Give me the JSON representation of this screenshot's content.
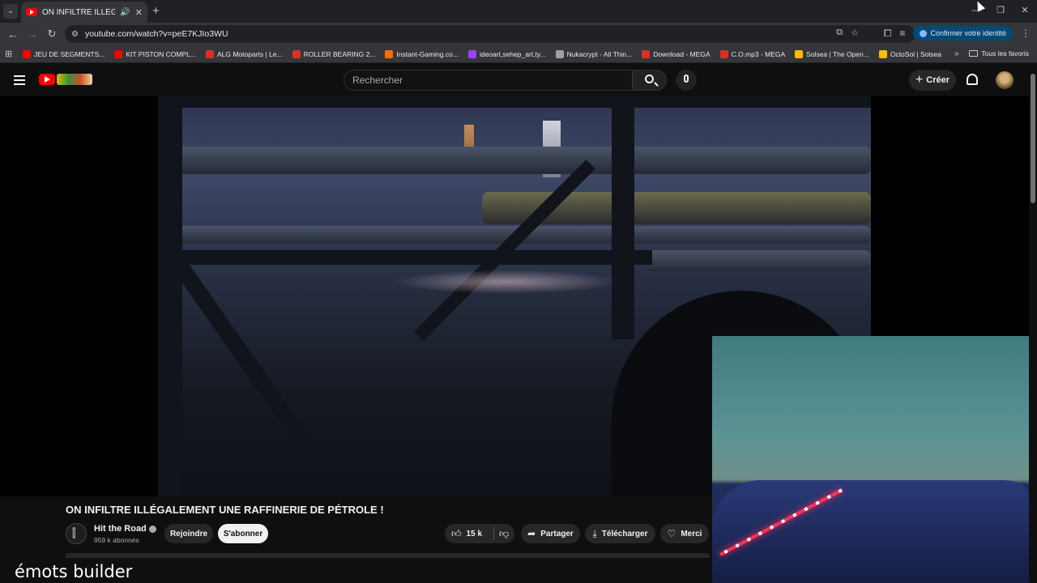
{
  "browser": {
    "tab": {
      "title": "ON INFILTRE ILLÉGALEMEN",
      "audio_icon": "🔊",
      "close": "✕"
    },
    "new_tab": "+",
    "window_controls": {
      "minimize": "—",
      "restore": "❐",
      "close": "✕"
    },
    "url": "youtube.com/watch?v=peE7KJIo3WU",
    "identity_button": "Confirmer votre identité",
    "bookmarks": [
      {
        "label": "JEU DE SEGMENTS...",
        "color": "#ff0000"
      },
      {
        "label": "KIT PISTON COMPL...",
        "color": "#ff0000"
      },
      {
        "label": "ALG Motoparts | Le...",
        "color": "#d93025"
      },
      {
        "label": "ROLLER BEARING 2...",
        "color": "#d93025"
      },
      {
        "label": "Instant-Gaming.co...",
        "color": "#ff6d00"
      },
      {
        "label": "ideoart,sehep_art,ty...",
        "color": "#a142f4"
      },
      {
        "label": "Nukacrypt - All Thin...",
        "color": "#9aa0a6"
      },
      {
        "label": "Download - MEGA",
        "color": "#d93025"
      },
      {
        "label": "C.O.mp3 - MEGA",
        "color": "#d93025"
      },
      {
        "label": "Solsea | The Open...",
        "color": "#fbbc04"
      },
      {
        "label": "OctoSol | Solsea",
        "color": "#fbbc04"
      }
    ],
    "bookmarks_more": "»",
    "all_bookmarks": "Tous les favoris"
  },
  "youtube": {
    "search_placeholder": "Rechercher",
    "create_label": "Créer",
    "video_title": "ON INFILTRE ILLÉGALEMENT UNE RAFFINERIE DE PÉTROLE !",
    "channel_name": "Hit the Road",
    "subscribers": "959 k abonnés",
    "join_label": "Rejoindre",
    "subscribe_label": "S'abonner",
    "likes": "15 k",
    "share_label": "Partager",
    "download_label": "Télécharger",
    "thanks_label": "Merci"
  },
  "overlay_text": "émots builder"
}
